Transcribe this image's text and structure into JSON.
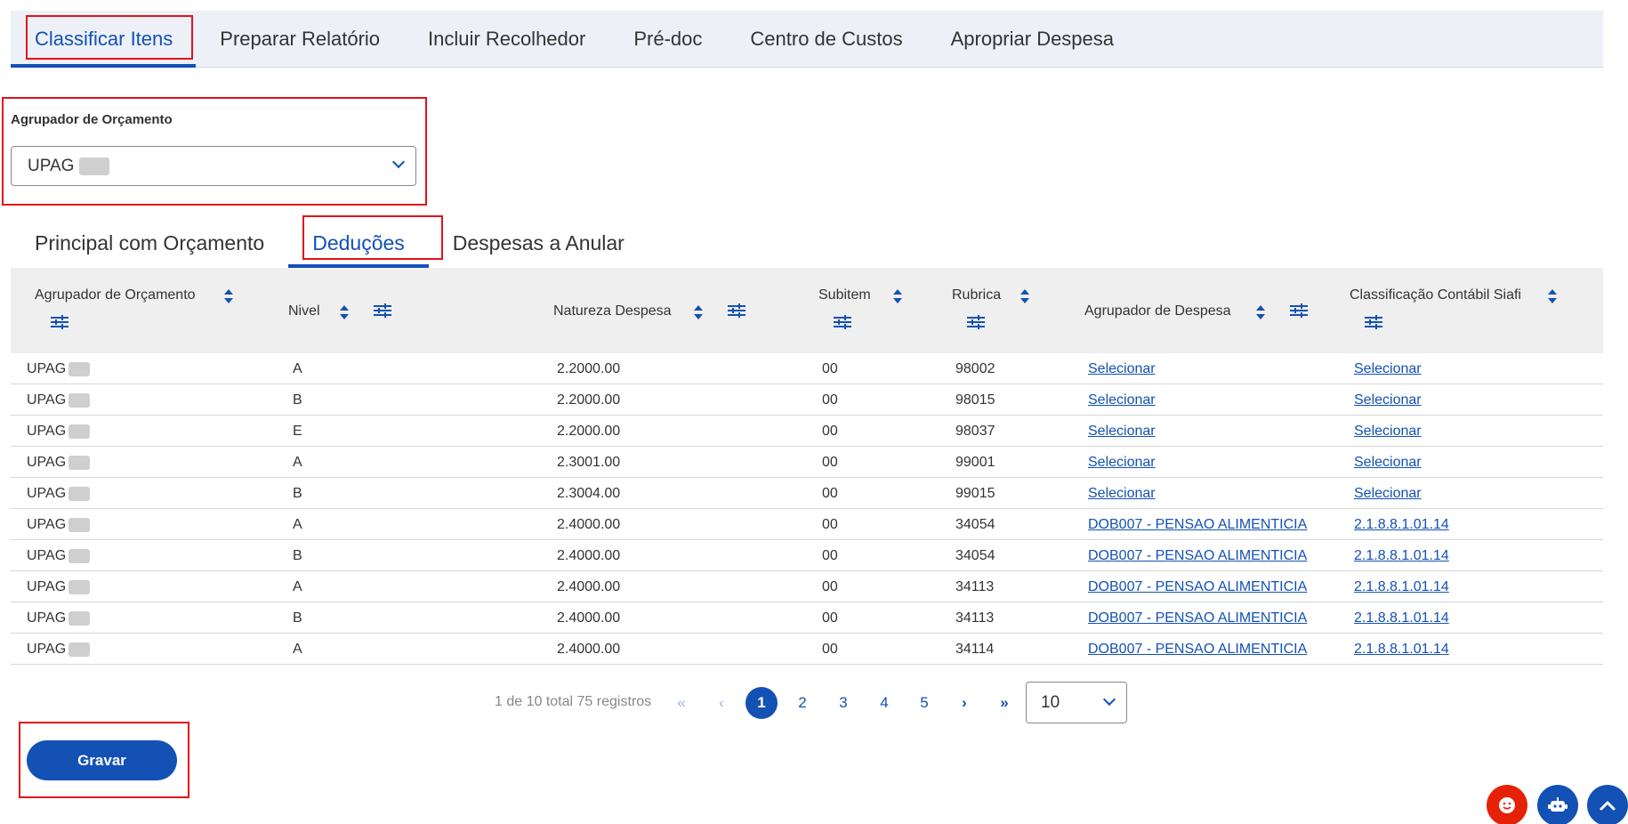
{
  "top_tabs": [
    {
      "label": "Classificar Itens"
    },
    {
      "label": "Preparar Relatório"
    },
    {
      "label": "Incluir Recolhedor"
    },
    {
      "label": "Pré-doc"
    },
    {
      "label": "Centro de Custos"
    },
    {
      "label": "Apropriar Despesa"
    }
  ],
  "agrupador": {
    "label": "Agrupador de Orçamento",
    "value": "UPAG"
  },
  "sub_tabs": [
    {
      "label": "Principal com Orçamento"
    },
    {
      "label": "Deduções"
    },
    {
      "label": "Despesas a Anular"
    }
  ],
  "table": {
    "columns": [
      "Agrupador de Orçamento",
      "Nivel",
      "Natureza Despesa",
      "Subitem",
      "Rubrica",
      "Agrupador de Despesa",
      "Classificação Contábil Siafi"
    ],
    "rows": [
      {
        "agrupador": "UPAG",
        "nivel": "A",
        "natureza": "2.2000.00",
        "subitem": "00",
        "rubrica": "98002",
        "agr_despesa": "Selecionar",
        "classificacao": "Selecionar"
      },
      {
        "agrupador": "UPAG",
        "nivel": "B",
        "natureza": "2.2000.00",
        "subitem": "00",
        "rubrica": "98015",
        "agr_despesa": "Selecionar",
        "classificacao": "Selecionar"
      },
      {
        "agrupador": "UPAG",
        "nivel": "E",
        "natureza": "2.2000.00",
        "subitem": "00",
        "rubrica": "98037",
        "agr_despesa": "Selecionar",
        "classificacao": "Selecionar"
      },
      {
        "agrupador": "UPAG",
        "nivel": "A",
        "natureza": "2.3001.00",
        "subitem": "00",
        "rubrica": "99001",
        "agr_despesa": "Selecionar",
        "classificacao": "Selecionar"
      },
      {
        "agrupador": "UPAG",
        "nivel": "B",
        "natureza": "2.3004.00",
        "subitem": "00",
        "rubrica": "99015",
        "agr_despesa": "Selecionar",
        "classificacao": "Selecionar"
      },
      {
        "agrupador": "UPAG",
        "nivel": "A",
        "natureza": "2.4000.00",
        "subitem": "00",
        "rubrica": "34054",
        "agr_despesa": "DOB007 - PENSAO ALIMENTICIA",
        "classificacao": "2.1.8.8.1.01.14"
      },
      {
        "agrupador": "UPAG",
        "nivel": "B",
        "natureza": "2.4000.00",
        "subitem": "00",
        "rubrica": "34054",
        "agr_despesa": "DOB007 - PENSAO ALIMENTICIA",
        "classificacao": "2.1.8.8.1.01.14"
      },
      {
        "agrupador": "UPAG",
        "nivel": "A",
        "natureza": "2.4000.00",
        "subitem": "00",
        "rubrica": "34113",
        "agr_despesa": "DOB007 - PENSAO ALIMENTICIA",
        "classificacao": "2.1.8.8.1.01.14"
      },
      {
        "agrupador": "UPAG",
        "nivel": "B",
        "natureza": "2.4000.00",
        "subitem": "00",
        "rubrica": "34113",
        "agr_despesa": "DOB007 - PENSAO ALIMENTICIA",
        "classificacao": "2.1.8.8.1.01.14"
      },
      {
        "agrupador": "UPAG",
        "nivel": "A",
        "natureza": "2.4000.00",
        "subitem": "00",
        "rubrica": "34114",
        "agr_despesa": "DOB007 - PENSAO ALIMENTICIA",
        "classificacao": "2.1.8.8.1.01.14"
      }
    ]
  },
  "pagination": {
    "info": "1 de 10 total 75 registros",
    "pages": [
      "1",
      "2",
      "3",
      "4",
      "5"
    ],
    "current": "1",
    "page_size": "10"
  },
  "actions": {
    "save_label": "Gravar"
  },
  "icons": {
    "first": "double-chevron-left-icon",
    "prev": "chevron-left-icon",
    "next": "chevron-right-icon",
    "last": "double-chevron-right-icon",
    "chat": "smiley-chat-icon",
    "bot": "robot-icon",
    "scroll_top": "chevron-up-icon"
  },
  "colors": {
    "primary": "#1351b4",
    "highlight_box": "#e0121c",
    "chat_button": "#e52207"
  }
}
